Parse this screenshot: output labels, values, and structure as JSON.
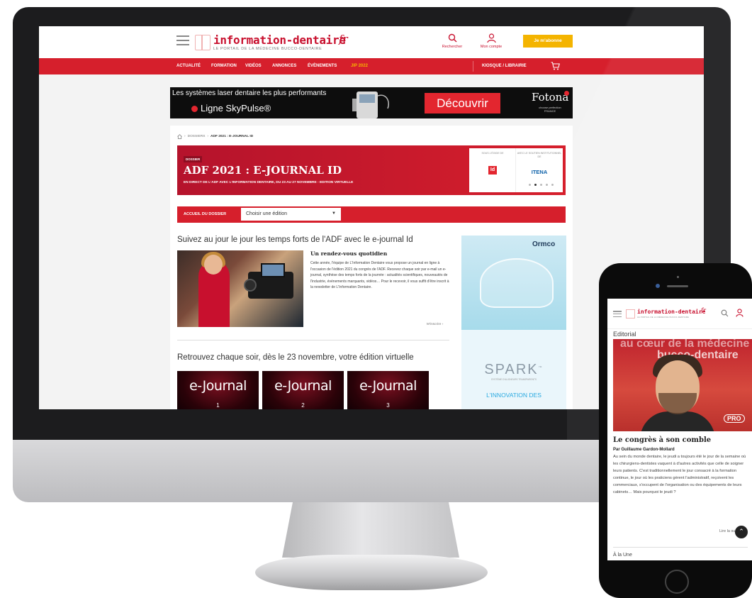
{
  "desktop": {
    "header": {
      "logo_text": "information-dentaire",
      "logo_suffix": "fr",
      "tagline": "LE PORTAIL DE LA MÉDECINE BUCCO-DENTAIRE",
      "search_label": "Rechercher",
      "account_label": "Mon compte",
      "subscribe_label": "Je m'abonne"
    },
    "nav": {
      "items": [
        "ACTUALITÉ",
        "FORMATION",
        "VIDÉOS",
        "ANNONCES",
        "ÉVÈNEMENTS",
        "JIP 2022"
      ],
      "kiosque": "KIOSQUE / LIBRAIRIE"
    },
    "banner": {
      "line1": "Les systèmes laser dentaire les plus performants",
      "line2": "Ligne SkyPulse®",
      "cta": "Découvrir",
      "brand": "Fotona",
      "brand_sub1": "choose perfection",
      "brand_sub2": "FRANCE"
    },
    "breadcrumb": {
      "level1": "DOSSIERS",
      "current": "ADF 2021 : E-JOURNAL ID"
    },
    "hero": {
      "tag": "DOSSIER",
      "title": "ADF 2021 : E-JOURNAL ID",
      "subtitle": "EN DIRECT DE L'ADF AVEC L'INFORMATION DENTAIRE, DU 23 AU 27 NOVEMBRE - EDITION VIRTUELLE",
      "egide_label": "SOUS L'ÉGIDE DE",
      "soutien_label": "AVEC LE SOUTIEN INSTITUTIONNEL DE",
      "partner2": "ITENA",
      "carousel_active": 1
    },
    "dossier_bar": {
      "label": "ACCUEIL DU DOSSIER",
      "select_value": "Choisir une édition"
    },
    "section1_title": "Suivez au jour le jour les temps forts de l'ADF avec le e-journal Id",
    "article": {
      "headline": "Un rendez-vous quotidien",
      "body": "Cette année, l'équipe de L'Information Dentaire vous propose un journal en ligne à l'occasion de l'édition 2021 du congrès de l'ADF. Recevez chaque soir par e-mail un e-journal, synthèse des temps forts de la journée : actualités scientifiques, nouveautés de l'industrie, événements marquants, vidéos… Pour le recevoir, il vous suffit d'être inscrit à la newsletter de L'Information Dentaire.",
      "more": "M'inscrire ›"
    },
    "section2_title": "Retrouvez chaque soir, dès le 23 novembre, votre édition virtuelle",
    "ejournal_cards": [
      {
        "word": "e-Journal",
        "num": "1"
      },
      {
        "word": "e-Journal",
        "num": "2"
      },
      {
        "word": "e-Journal",
        "num": "3"
      }
    ],
    "side_ad": {
      "brand": "Ormco",
      "product": "SPARK",
      "product_tm": "™",
      "product_sub": "SYSTÈME D'ALIGNEURS TRANSPARENTS",
      "tagline": "L'INNOVATION DES"
    }
  },
  "phone": {
    "logo_text": "information-dentaire",
    "logo_suffix": "fr",
    "tagline": "LE PORTAIL DE LA MÉDECINE BUCCO-DENTAIRE",
    "section": "Editorial",
    "photo_text1": "au cœur de la médecine",
    "photo_text2": "bucco-dentaire",
    "photo_badge": "PRO",
    "title": "Le congrès à son comble",
    "author": "Par Guillaume Gardon-Mollard",
    "body": "Au sein du monde dentaire, le jeudi a toujours été le jour de la semaine où les chirurgiens-dentistes vaquent à d'autres activités que celle de soigner leurs patients. C'est traditionnellement le jour consacré à la formation continue, le jour où les praticiens gèrent l'administratif, reçoivent les commerciaux, s'occupent de l'organisation ou des équipements de leurs cabinets… Mais pourquoi le jeudi ?",
    "more": "Lire la suite ›",
    "next_section": "À la Une"
  },
  "colors": {
    "brand_red": "#d61f2c",
    "accent_yellow": "#f4b400",
    "dark_bezel": "#1c1c1e"
  }
}
